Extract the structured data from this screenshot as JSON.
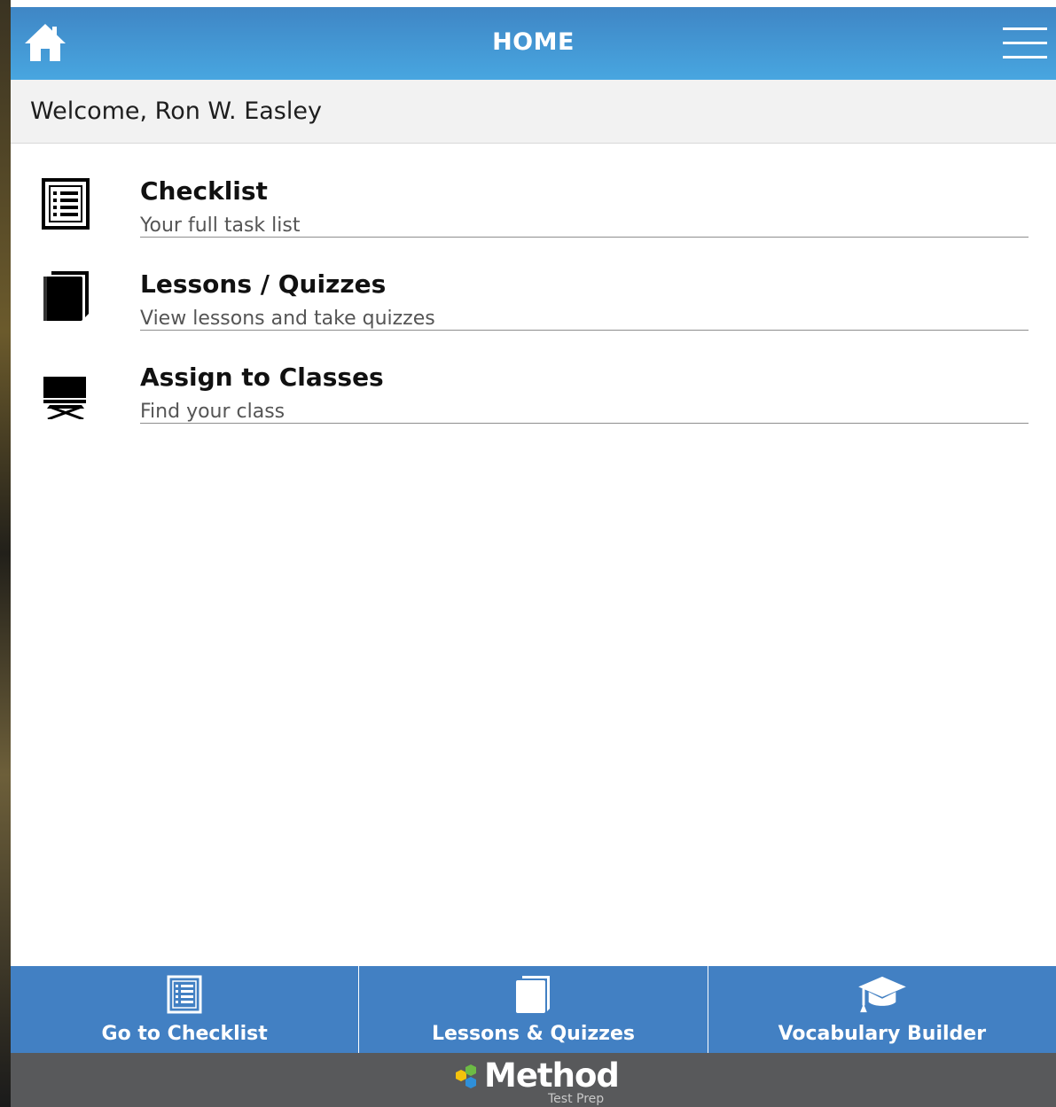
{
  "header": {
    "title": "HOME",
    "home_icon": "home-icon",
    "menu_icon": "hamburger-menu-icon",
    "gradient_top": "#3f86c5",
    "gradient_bottom": "#48a6e0"
  },
  "welcome": {
    "text": "Welcome, Ron W. Easley"
  },
  "items": [
    {
      "title": "Checklist",
      "subtitle": "Your full task list",
      "icon": "checklist-icon"
    },
    {
      "title": "Lessons / Quizzes",
      "subtitle": "View lessons and take quizzes",
      "icon": "book-icon"
    },
    {
      "title": "Assign to Classes",
      "subtitle": "Find your class",
      "icon": "classroom-easel-icon"
    }
  ],
  "bottom_nav": {
    "background": "#4280c3",
    "buttons": [
      {
        "label": "Go to Checklist",
        "icon": "checklist-icon"
      },
      {
        "label": "Lessons & Quizzes",
        "icon": "book-icon"
      },
      {
        "label": "Vocabulary Builder",
        "icon": "graduation-cap-icon"
      }
    ]
  },
  "footer": {
    "brand": "Method",
    "tagline": "Test Prep",
    "background": "#58595b"
  }
}
